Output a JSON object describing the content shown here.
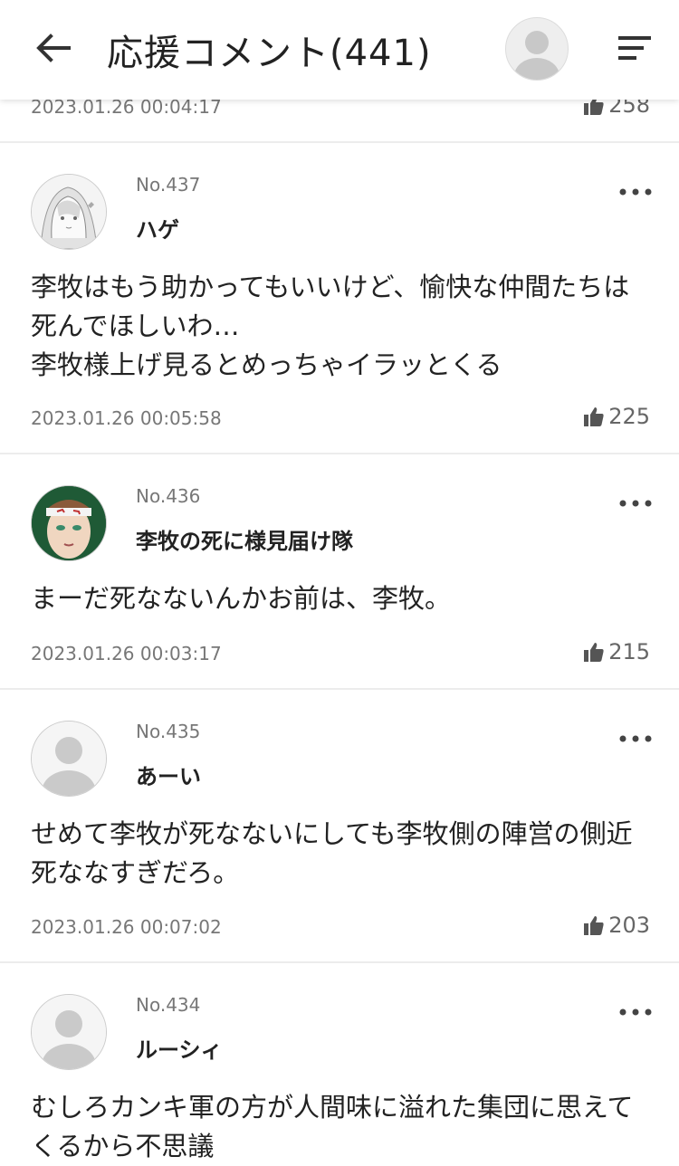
{
  "header": {
    "title": "応援コメント(441)",
    "back_icon": "arrow-left-icon",
    "avatar_icon": "user-avatar-icon",
    "menu_icon": "sort-menu-icon"
  },
  "partial": {
    "date": "2023.01.26 00:04:17",
    "likes": "258"
  },
  "comments": [
    {
      "no": "No.437",
      "name": "ハゲ",
      "lines": [
        "李牧はもう助かってもいいけど、愉快な仲間たちは",
        "死んでほしいわ…",
        "李牧様上げ見るとめっちゃイラッとくる"
      ],
      "date": "2023.01.26 00:05:58",
      "likes": "225"
    },
    {
      "no": "No.436",
      "name": "李牧の死に様見届け隊",
      "lines": [
        "まーだ死なないんかお前は、李牧。"
      ],
      "date": "2023.01.26 00:03:17",
      "likes": "215"
    },
    {
      "no": "No.435",
      "name": "あーい",
      "lines": [
        "せめて李牧が死なないにしても李牧側の陣営の側近",
        "死ななすぎだろ。"
      ],
      "date": "2023.01.26 00:07:02",
      "likes": "203"
    },
    {
      "no": "No.434",
      "name": "ルーシィ",
      "lines": [
        "むしろカンキ軍の方が人間味に溢れた集団に思えて",
        "くるから不思議"
      ]
    }
  ],
  "icons": {
    "like": "thumbs-up-icon",
    "more": "more-horizontal-icon"
  },
  "colors": {
    "accent_text": "#222222",
    "meta_text": "#777777",
    "divider": "#ececec"
  }
}
